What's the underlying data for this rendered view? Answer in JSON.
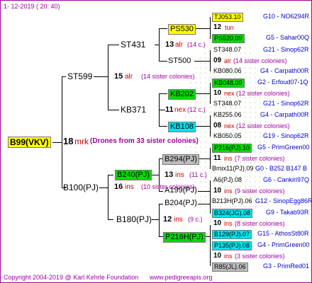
{
  "header": {
    "date": "1-  12-2019  (  20:  40)"
  },
  "footer": {
    "copyright": "Copyright 2004-2019 @ Karl Kehrle Foundation",
    "url": "www.pedigreeapis.org"
  },
  "colors": {
    "purple": "#a000a0",
    "red": "#cc0000",
    "blue": "#0000cc",
    "green": "#008000",
    "highlight_yellow": "#ffff00",
    "highlight_green": "#00dd00",
    "highlight_cyan": "#00e5ee",
    "highlight_gray": "#bdbdbd"
  },
  "root": {
    "label": "B99(VKV)",
    "gen": "18",
    "breed": "mrk",
    "note": "(Drones from 33 sister colonies)"
  },
  "left": {
    "sire": "ST599",
    "gen": "15",
    "breed": "alr",
    "note": "(14 sister colonies)",
    "a": {
      "sire": "ST431",
      "gen": "13",
      "breed": "alr",
      "note": "(14 c.)"
    },
    "b": {
      "sire": "KB371",
      "gen": "11",
      "breed": "nex",
      "note": "(12 c.)"
    }
  },
  "right": {
    "sire": "B100(PJ)",
    "gen": "16",
    "breed": "ins",
    "note": "(10 sister colonies)",
    "a": {
      "sire": "A199(PJ)",
      "gen": "13",
      "breed": "ins",
      "note": "(11 c.)"
    },
    "b": {
      "sire": "B180(PJ)",
      "gen": "12",
      "breed": "ins",
      "note": "(9 c.)"
    }
  },
  "g3": [
    {
      "label": "PS530"
    },
    {
      "label": "ST500"
    },
    {
      "label": "KB202"
    },
    {
      "label": "KB108"
    },
    {
      "label": "B294(PJ)"
    },
    {
      "label": "B240(PJ)"
    },
    {
      "label": "B204(PJ)"
    },
    {
      "label": "P216H(PJ)"
    }
  ],
  "g4": [
    {
      "label": "TJ053.10",
      "info": "G10 - NO6294R"
    },
    {
      "label": "12",
      "extra": "tun"
    },
    {
      "label": "PS520.09",
      "info": "G5 - Sahar00Q"
    },
    {
      "label": "ST348.07",
      "info": "G21 - Sinop62R"
    },
    {
      "label": "09",
      "extra": "alr",
      "note": "(14 sister colonies)"
    },
    {
      "label": "KB080.06",
      "info": "G4 - Carpath00R"
    },
    {
      "label": "KB048.09",
      "info": "G2 - Erfoud07-1Q"
    },
    {
      "label": "10",
      "extra": "nex",
      "note": "(12 sister colonies)"
    },
    {
      "label": "ST348.07",
      "info": "G21 - Sinop62R"
    },
    {
      "label": "KB255.06",
      "info": "G4 - Carpath00R"
    },
    {
      "label": "08",
      "extra": "nex",
      "note": "(12 sister colonies)"
    },
    {
      "label": "KB050.05",
      "info": "G19 - Sinop62R"
    },
    {
      "label": "P216(PJ).10",
      "info": "G5 - PrimGreen00"
    },
    {
      "label": "11",
      "extra": "ins",
      "note": "(7 sister colonies)"
    },
    {
      "label": "Bmix11(PJ).09",
      "info": "G0 - B252 B147 B"
    },
    {
      "label": "A6(PJ).08",
      "info": "G6 - Cankiri97Q"
    },
    {
      "label": "10",
      "extra": "ins",
      "note": "(9 sister colonies)"
    },
    {
      "label": "B213H(PJ).06",
      "info": "G12 - SinopEgg86R"
    },
    {
      "label": "B324(JG).08",
      "info": "G9 - Takab93R"
    },
    {
      "label": "10",
      "extra": "ins",
      "note": "(8 sister colonies)"
    },
    {
      "label": "B129(PJ).07",
      "info": "G15 - AthosSt80R"
    },
    {
      "label": "P135(PJ).08",
      "info": "G4 - PrimGreen00"
    },
    {
      "label": "10",
      "extra": "ins",
      "note": "(3 sister colonies)"
    },
    {
      "label": "R85(JL).06",
      "info": "G3 - PrimRed01"
    }
  ]
}
